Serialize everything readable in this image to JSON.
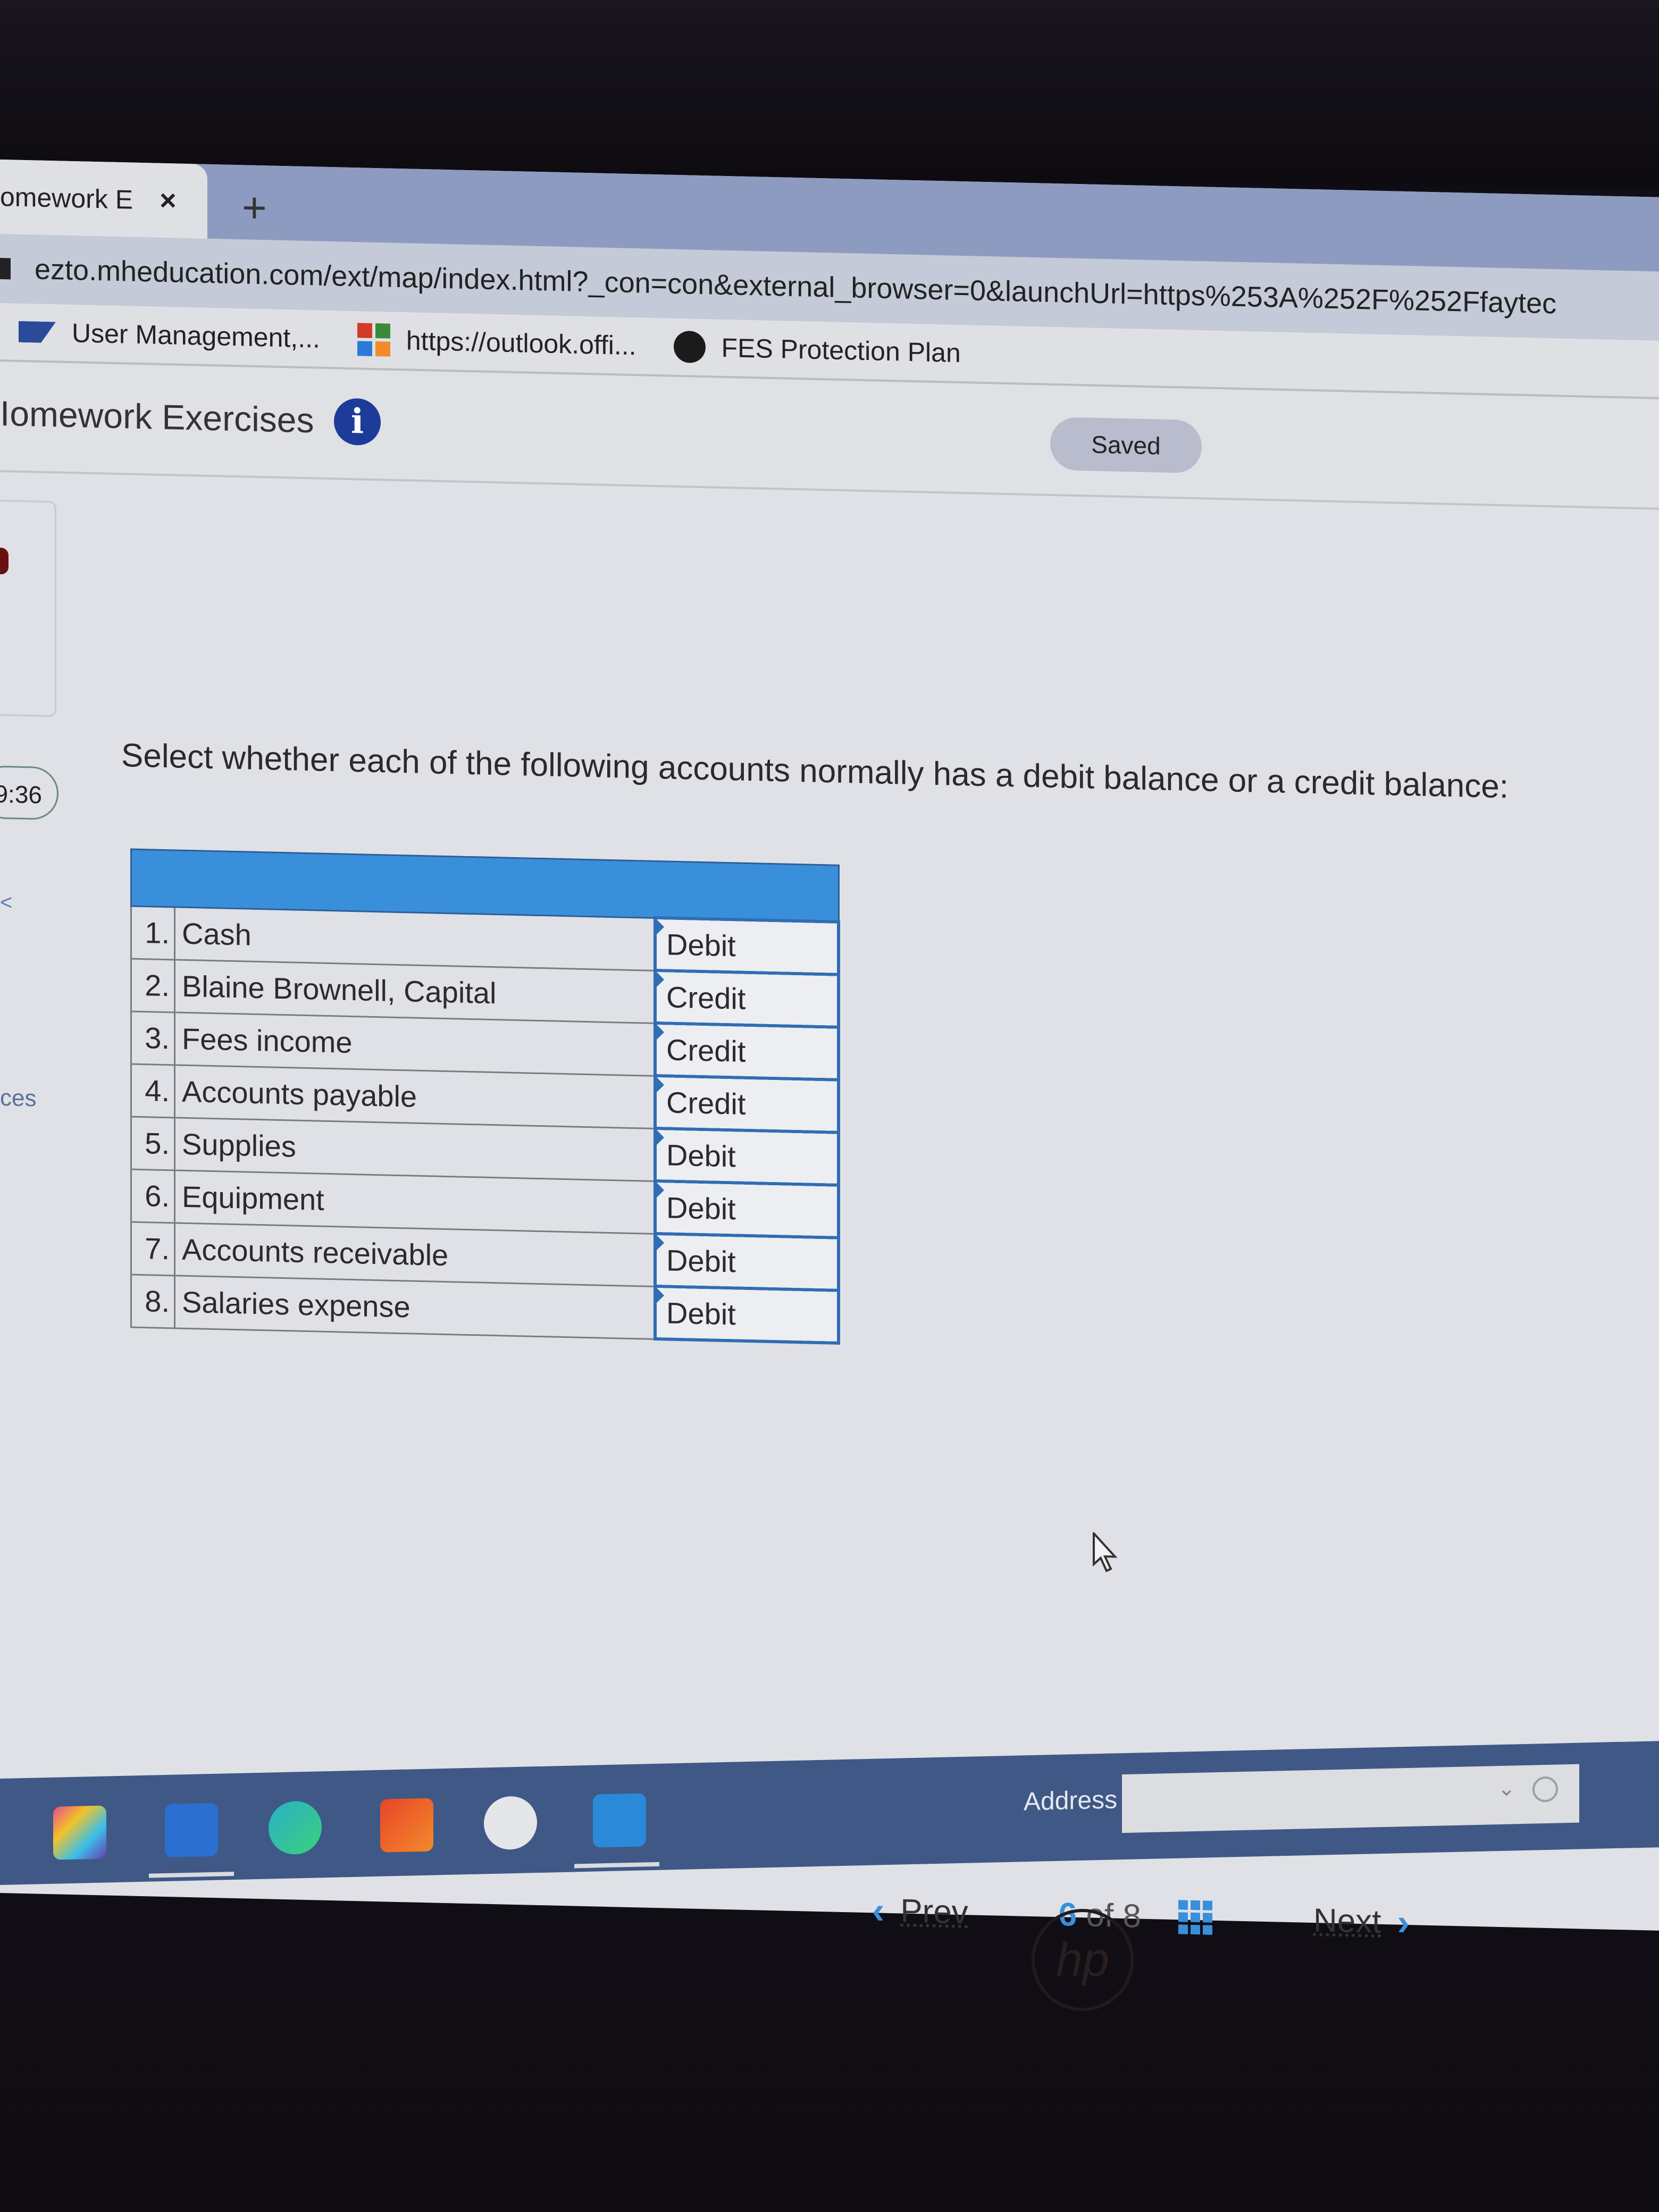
{
  "browser": {
    "tab_title": "omework E",
    "tab_close_icon": "×",
    "new_tab_icon": "+",
    "url": "ezto.mheducation.com/ext/map/index.html?_con=con&external_browser=0&launchUrl=https%253A%252F%252Ffaytec",
    "bookmarks": [
      {
        "label": "User Management,...",
        "icon": "sap-icon"
      },
      {
        "label": "https://outlook.offi...",
        "icon": "microsoft-icon"
      },
      {
        "label": "FES Protection Plan",
        "icon": "fes-icon"
      }
    ]
  },
  "header": {
    "title": "Iomework Exercises",
    "info_icon": "i",
    "saved_badge": "Saved"
  },
  "sidebar": {
    "timer": "9:36",
    "chevron": "<",
    "references_label": "ces"
  },
  "question": {
    "prompt": "Select whether each of the following accounts normally has a debit balance or a credit balance:",
    "rows": [
      {
        "num": "1.",
        "account": "Cash",
        "selection": "Debit"
      },
      {
        "num": "2.",
        "account": "Blaine Brownell, Capital",
        "selection": "Credit"
      },
      {
        "num": "3.",
        "account": "Fees income",
        "selection": "Credit"
      },
      {
        "num": "4.",
        "account": "Accounts payable",
        "selection": "Credit"
      },
      {
        "num": "5.",
        "account": "Supplies",
        "selection": "Debit"
      },
      {
        "num": "6.",
        "account": "Equipment",
        "selection": "Debit"
      },
      {
        "num": "7.",
        "account": "Accounts receivable",
        "selection": "Debit"
      },
      {
        "num": "8.",
        "account": "Salaries expense",
        "selection": "Debit"
      }
    ]
  },
  "footer_nav": {
    "prev_label": "Prev",
    "current_page": "6",
    "of_label": "of",
    "total_pages": "8",
    "next_label": "Next"
  },
  "taskbar": {
    "address_label": "Address",
    "address_value": ""
  },
  "colors": {
    "accent_blue": "#3a8fda",
    "dropdown_border": "#2f6db5",
    "info_icon_bg": "#1d3b99",
    "taskbar_bg": "#3f5886"
  }
}
